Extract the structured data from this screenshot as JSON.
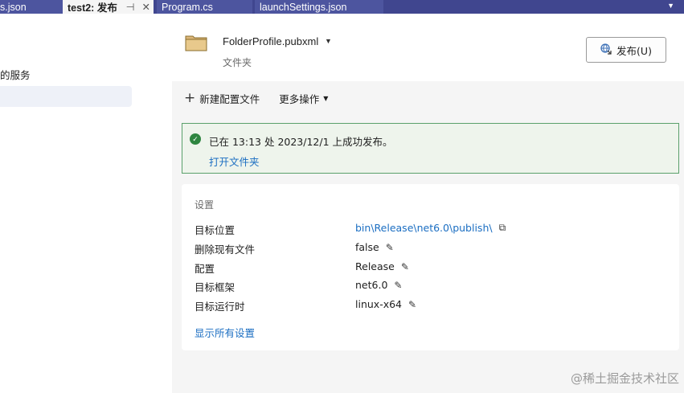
{
  "tabs": [
    {
      "label": "s.json"
    },
    {
      "label": "test2: 发布",
      "pin_icon": "⊣",
      "close_icon": "✕"
    },
    {
      "label": "Program.cs"
    },
    {
      "label": "launchSettings.json"
    }
  ],
  "tab_overflow_icon": "▼",
  "left_pane": {
    "service_text": "的服务"
  },
  "header": {
    "profile_name": "FolderProfile.pubxml",
    "profile_caret": "▼",
    "profile_type": "文件夹",
    "publish_button": "发布(U)"
  },
  "toolbar": {
    "new_profile": "新建配置文件",
    "more_actions": "更多操作",
    "plus_glyph": "+",
    "caret_glyph": "▼"
  },
  "status": {
    "message": "已在 13:13 处 2023/12/1 上成功发布。",
    "open_folder": "打开文件夹",
    "check_glyph": "✓"
  },
  "settings": {
    "title": "设置",
    "rows": [
      {
        "key": "目标位置",
        "value": "bin\\Release\\net6.0\\publish\\"
      },
      {
        "key": "删除现有文件",
        "value": "false"
      },
      {
        "key": "配置",
        "value": "Release"
      },
      {
        "key": "目标框架",
        "value": "net6.0"
      },
      {
        "key": "目标运行时",
        "value": "linux-x64"
      }
    ],
    "show_all": "显示所有设置",
    "edit_glyph": "✎",
    "copy_glyph": "⧉"
  },
  "watermark": "@稀土掘金技术社区",
  "colors": {
    "tabbar": "#40468f",
    "link": "#1b6ec2",
    "success_border": "#5aa06b",
    "success_check": "#2e8540"
  }
}
